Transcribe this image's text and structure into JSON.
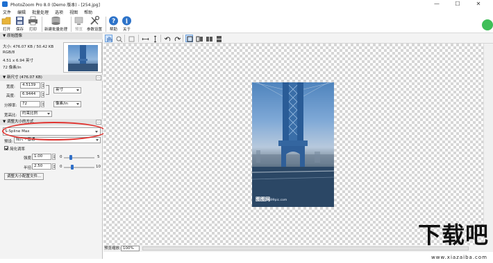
{
  "window": {
    "title": "PhotoZoom Pro 8.0 (Demo 版本) - [254.jpg]",
    "min": "—",
    "max": "☐",
    "close": "✕"
  },
  "menu": [
    "文件",
    "编辑",
    "批量处理",
    "选项",
    "视图",
    "帮助"
  ],
  "toolbar": [
    "打开",
    "保存",
    "打印",
    "新建批量处理",
    "预览",
    "参数设置",
    "帮助",
    "关于"
  ],
  "sidebar": {
    "original_image": {
      "title": "▼ 原始图像",
      "size": "大小: 476.07 KB / 50.42 KB",
      "color_mode": "RGB/8",
      "dimensions": "4.51 x 6.94 英寸",
      "resolution": "72 像素/in"
    },
    "new_size": {
      "title": "▼ 新尺寸 (476.07 KB)",
      "width_label": "宽度:",
      "width_value": "4.5139",
      "height_label": "高度:",
      "height_value": "6.9444",
      "unit": "英寸",
      "resolution_label": "分辨率:",
      "resolution_value": "72",
      "resolution_unit": "像素/in",
      "aspect_label": "宽高比:",
      "aspect_value": "约束比例"
    },
    "resize_method": {
      "title": "▼ 调整大小的方式",
      "method": "S-Spline Max",
      "preset_label": "预设:",
      "preset_value": "照片 - 普通",
      "ext_checkbox_label": "简化调率",
      "strength_label": "强度:",
      "strength_value": "1.00",
      "strength_min": "0",
      "strength_max": "5",
      "radius_label": "半径:",
      "radius_value": "2.50",
      "radius_min": "0",
      "radius_max": "10",
      "profile_button": "调整大小配置文件..."
    }
  },
  "status": {
    "preview_zoom_label": "预览缩放:",
    "zoom_value": "100%"
  },
  "photo": {
    "watermark": "图图网",
    "watermark_sub": "699pic.com"
  },
  "branding": {
    "logo_text": "下载吧",
    "url": "www.xiazaiba.com"
  }
}
